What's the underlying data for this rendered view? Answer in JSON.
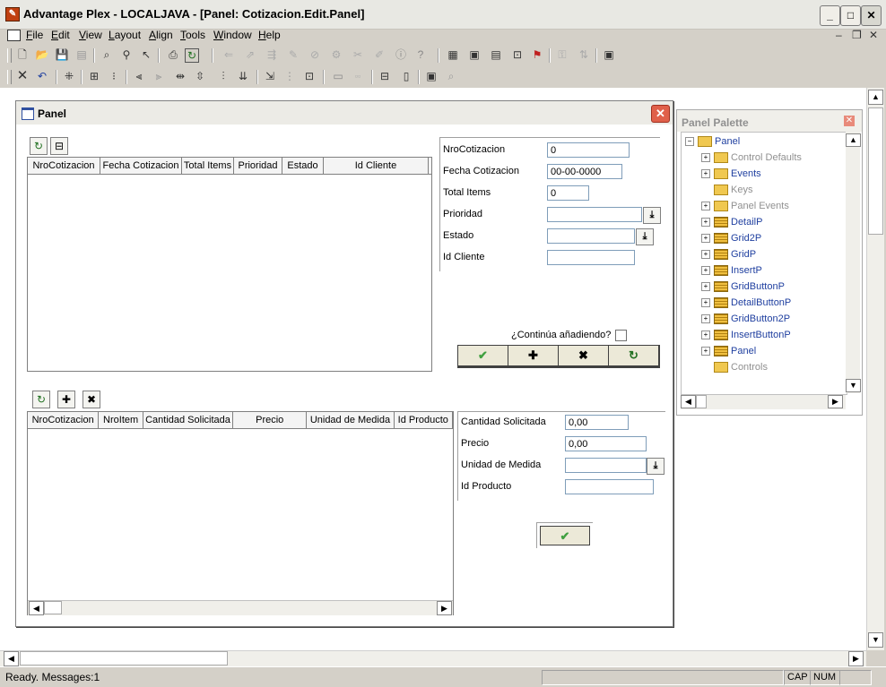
{
  "app": {
    "title": "Advantage Plex - LOCALJAVA - [Panel: Cotizacion.Edit.Panel]",
    "icon": "app-icon",
    "window_buttons": {
      "minimize": "_",
      "maximize": "□",
      "close": "✕"
    }
  },
  "menu": {
    "items": [
      "File",
      "Edit",
      "View",
      "Layout",
      "Align",
      "Tools",
      "Window",
      "Help"
    ],
    "mdi_controls": {
      "minimize": "–",
      "restore": "❐",
      "close": "✕"
    }
  },
  "toolbar1": {
    "icons": [
      "new-icon",
      "open-icon",
      "save-icon",
      "save-all-icon",
      "find-icon",
      "find-next-icon",
      "pointer-icon",
      "print-icon",
      "refresh-icon",
      "back-icon",
      "forward-icon",
      "link-icon",
      "edit-icon",
      "clear-icon",
      "properties-icon",
      "info-icon",
      "help-icon",
      "panel-icon",
      "layout-icon",
      "grid-icon",
      "button-icon",
      "flag-icon",
      "key-icon",
      "tree-icon",
      "view-icon"
    ]
  },
  "toolbar2": {
    "icons": [
      "delete-icon",
      "undo-icon",
      "snap-icon",
      "center-icon",
      "group-icon",
      "align-left-icon",
      "align-right-icon",
      "space-h-icon",
      "space-v-icon",
      "distribute-icon",
      "order-icon",
      "tab-order-icon",
      "grid-toggle-icon",
      "size-icon",
      "properties-icon",
      "palette-icon",
      "zoom-icon"
    ]
  },
  "panel_window": {
    "title": "Panel",
    "close": "✕"
  },
  "grid1": {
    "toolbar_icons": [
      "refresh-icon",
      "hierarchy-icon"
    ],
    "columns": [
      "NroCotizacion",
      "Fecha Cotizacion",
      "Total Items",
      "Prioridad",
      "Estado",
      "Id Cliente"
    ]
  },
  "detail1": {
    "fields": [
      {
        "label": "NroCotizacion",
        "value": "0",
        "dropdown": false
      },
      {
        "label": "Fecha Cotizacion",
        "value": "00-00-0000",
        "dropdown": false
      },
      {
        "label": "Total Items",
        "value": "0",
        "dropdown": false
      },
      {
        "label": "Prioridad",
        "value": "",
        "dropdown": true
      },
      {
        "label": "Estado",
        "value": "",
        "dropdown": true
      },
      {
        "label": "Id Cliente",
        "value": "",
        "dropdown": false
      }
    ],
    "continue_label": "¿Continúa añadiendo?",
    "continue_checked": false,
    "buttons": [
      "ok-icon",
      "add-icon",
      "delete-icon",
      "refresh-icon"
    ]
  },
  "grid2": {
    "toolbar_icons": [
      "refresh-icon",
      "add-icon",
      "delete-icon"
    ],
    "columns": [
      "NroCotizacion",
      "NroItem",
      "Cantidad Solicitada",
      "Precio",
      "Unidad de Medida",
      "Id Producto"
    ]
  },
  "detail2": {
    "fields": [
      {
        "label": "Cantidad Solicitada",
        "value": "0,00",
        "dropdown": false
      },
      {
        "label": "Precio",
        "value": "0,00",
        "dropdown": false
      },
      {
        "label": "Unidad de Medida",
        "value": "",
        "dropdown": true
      },
      {
        "label": "Id Producto",
        "value": "",
        "dropdown": false
      }
    ],
    "ok_button": "ok-icon"
  },
  "palette": {
    "title": "Panel Palette",
    "root": "Panel",
    "items": [
      {
        "label": "Control Defaults",
        "kind": "folder",
        "expandable": true,
        "enabled": false
      },
      {
        "label": "Events",
        "kind": "folder",
        "expandable": true,
        "enabled": true
      },
      {
        "label": "Keys",
        "kind": "folder",
        "expandable": false,
        "enabled": false
      },
      {
        "label": "Panel Events",
        "kind": "folder",
        "expandable": true,
        "enabled": false
      },
      {
        "label": "DetailP",
        "kind": "component",
        "expandable": true,
        "enabled": true
      },
      {
        "label": "Grid2P",
        "kind": "component",
        "expandable": true,
        "enabled": true
      },
      {
        "label": "GridP",
        "kind": "component",
        "expandable": true,
        "enabled": true
      },
      {
        "label": "InsertP",
        "kind": "component",
        "expandable": true,
        "enabled": true
      },
      {
        "label": "GridButtonP",
        "kind": "component",
        "expandable": true,
        "enabled": true
      },
      {
        "label": "DetailButtonP",
        "kind": "component",
        "expandable": true,
        "enabled": true
      },
      {
        "label": "GridButton2P",
        "kind": "component",
        "expandable": true,
        "enabled": true
      },
      {
        "label": "InsertButtonP",
        "kind": "component",
        "expandable": true,
        "enabled": true
      },
      {
        "label": "Panel",
        "kind": "component",
        "expandable": true,
        "enabled": true
      },
      {
        "label": "Controls",
        "kind": "folder",
        "expandable": false,
        "enabled": false
      }
    ]
  },
  "status": {
    "message": "Ready.  Messages:1",
    "caps": "CAP",
    "num": "NUM"
  }
}
